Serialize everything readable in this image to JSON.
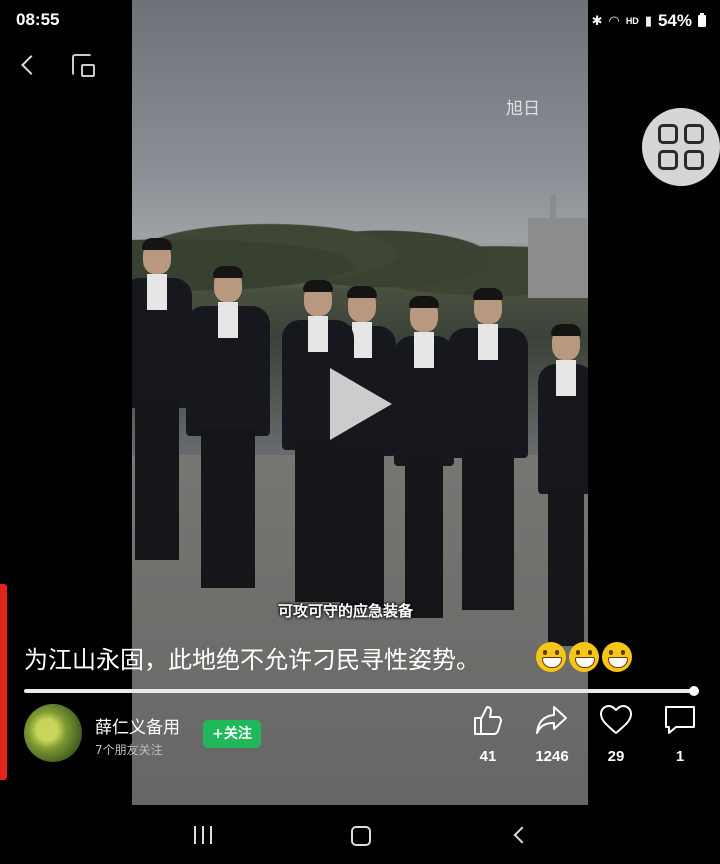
{
  "status_bar": {
    "time": "08:55",
    "network_badge": "HD",
    "battery": "54%"
  },
  "video": {
    "watermark": "旭日",
    "caption": "可攻可守的应急装备",
    "state": "paused",
    "progress_fraction": 0.99
  },
  "post": {
    "title": "为江山永固，此地绝不允许刁民寻性姿势。",
    "emojis": [
      "grinning-face",
      "grinning-face",
      "grinning-face"
    ]
  },
  "author": {
    "name": "薛仁义备用",
    "followers_text": "7个朋友关注",
    "follow_label": "+关注",
    "follow_color": "#1fb85b"
  },
  "actions": [
    {
      "icon": "thumbs-up-icon",
      "count": "41"
    },
    {
      "icon": "share-icon",
      "count": "1246"
    },
    {
      "icon": "heart-icon",
      "count": "29"
    },
    {
      "icon": "comment-icon",
      "count": "1"
    }
  ],
  "colors": {
    "accent_red": "#e1251b",
    "background": "#000000"
  }
}
